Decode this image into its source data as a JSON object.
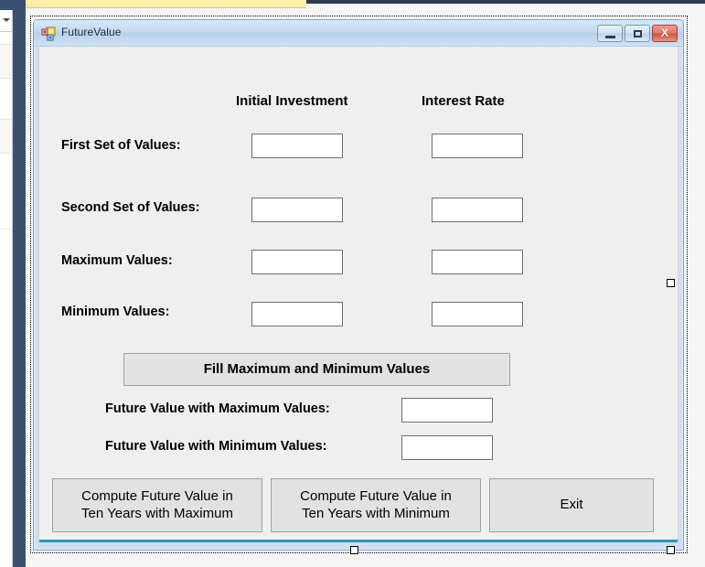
{
  "ide": {
    "left_panel": {
      "dropdown_icon": "chevron-down-icon"
    },
    "top_tab_color": "#ffeea8",
    "nav_strip_color": "#3b5070",
    "canvas_color": "#f5f5f5"
  },
  "form": {
    "title": "FutureValue",
    "icon": "winforms-form-icon",
    "titlebar_color": "#b6d0ea",
    "client_color": "#efefef",
    "window_buttons": [
      {
        "name": "minimize-button",
        "glyph": "minimize-icon",
        "label": ""
      },
      {
        "name": "maximize-button",
        "glyph": "maximize-icon",
        "label": ""
      },
      {
        "name": "close-button",
        "glyph": "close-icon",
        "label": "X"
      }
    ]
  },
  "columns": {
    "initial_investment": "Initial Investment",
    "interest_rate": "Interest Rate"
  },
  "rows": [
    {
      "label": "First Set of Values:",
      "investment_value": "",
      "rate_value": ""
    },
    {
      "label": "Second Set of Values:",
      "investment_value": "",
      "rate_value": ""
    },
    {
      "label": "Maximum Values:",
      "investment_value": "",
      "rate_value": ""
    },
    {
      "label": "Minimum Values:",
      "investment_value": "",
      "rate_value": ""
    }
  ],
  "fill_button": {
    "label": "Fill Maximum and Minimum Values"
  },
  "results": [
    {
      "label": "Future Value with Maximum Values:",
      "value": ""
    },
    {
      "label": "Future Value with Minimum Values:",
      "value": ""
    }
  ],
  "bottom_buttons": [
    {
      "label": "Compute Future Value in\nTen Years with Maximum"
    },
    {
      "label": "Compute Future Value in\nTen Years with Minimum"
    },
    {
      "label": "Exit"
    }
  ],
  "textbox_placeholder": ""
}
